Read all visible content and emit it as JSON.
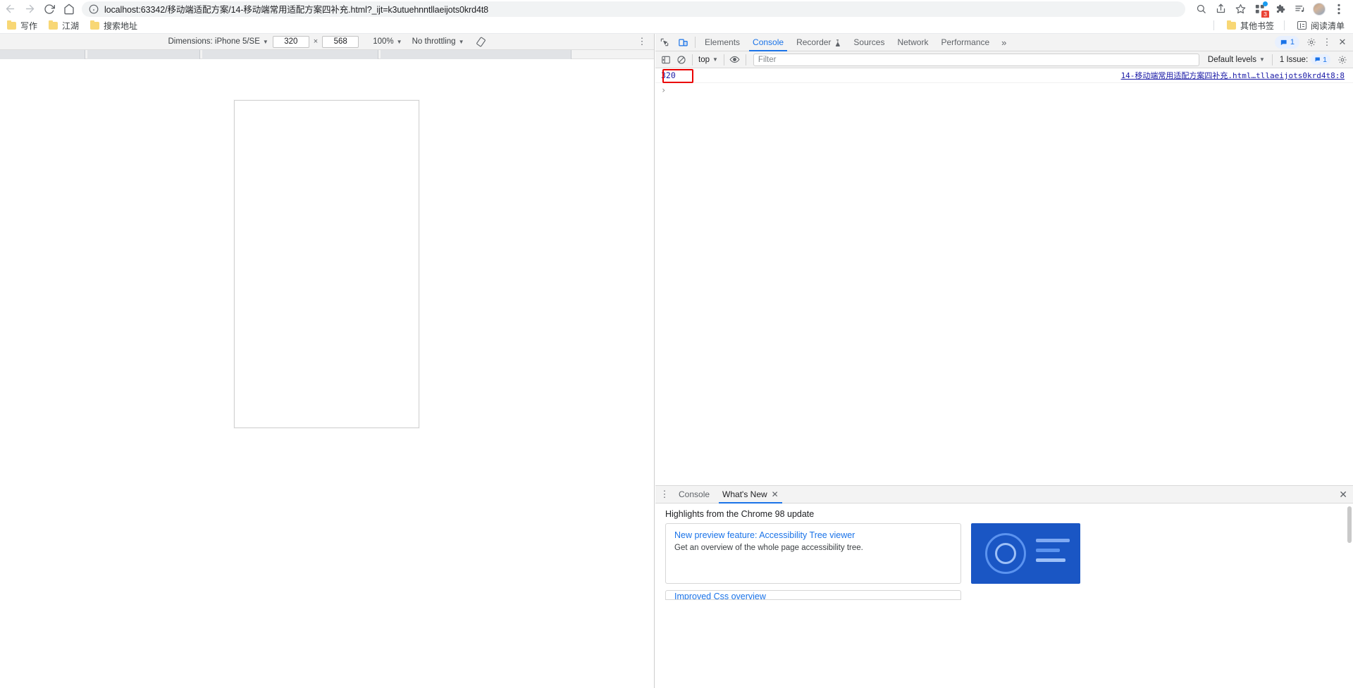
{
  "browser": {
    "url": "localhost:63342/移动端适配方案/14-移动端常用适配方案四补充.html?_ijt=k3utuehnntllaeijots0krd4t8",
    "nav": {
      "back": "back-arrow",
      "forward": "forward-arrow",
      "reload": "reload",
      "home": "home"
    },
    "toolbar_icons": [
      {
        "name": "search-icon",
        "label": ""
      },
      {
        "name": "share-icon",
        "label": ""
      },
      {
        "name": "bookmark-star-icon",
        "label": ""
      },
      {
        "name": "extensions-icon",
        "label": "",
        "badge": "3"
      },
      {
        "name": "puzzle-extension-icon",
        "label": ""
      },
      {
        "name": "reading-list-icon",
        "label": ""
      },
      {
        "name": "profile-avatar",
        "label": ""
      },
      {
        "name": "chrome-menu-icon",
        "label": "⋮"
      }
    ],
    "bookmarks": [
      {
        "label": "写作"
      },
      {
        "label": "江湖"
      },
      {
        "label": "搜索地址"
      }
    ],
    "bookmarks_right": [
      {
        "label": "其他书签"
      },
      {
        "label": "阅读清单"
      }
    ]
  },
  "device_toolbar": {
    "dimensions_label": "Dimensions: iPhone 5/SE",
    "width": "320",
    "height": "568",
    "times": "×",
    "zoom": "100%",
    "throttling": "No throttling",
    "rotate_title": "rotate-icon",
    "kebab": "⋮"
  },
  "devtools": {
    "tabs": [
      {
        "label": "Elements",
        "active": false
      },
      {
        "label": "Console",
        "active": true
      },
      {
        "label": "Recorder",
        "active": false,
        "badge": "rec"
      },
      {
        "label": "Sources",
        "active": false
      },
      {
        "label": "Network",
        "active": false
      },
      {
        "label": "Performance",
        "active": false
      }
    ],
    "more_tabs": "»",
    "issues_pill": "1",
    "gear": "⚙",
    "kebab": "⋮",
    "close": "✕",
    "console_toolbar": {
      "context": "top",
      "filter_placeholder": "Filter",
      "levels": "Default levels",
      "issues_text": "1 Issue:",
      "issues_count": "1"
    },
    "console_entries": [
      {
        "value": "320",
        "source": "14-移动端常用适配方案四补充.html…tllaeijots0krd4t8:8",
        "highlighted": true
      }
    ],
    "prompt_symbol": "›"
  },
  "drawer": {
    "tabs": [
      {
        "label": "Console",
        "active": false,
        "closable": false
      },
      {
        "label": "What's New",
        "active": true,
        "closable": true
      }
    ],
    "close_label": "✕",
    "kebab": "⋮",
    "heading": "Highlights from the Chrome 98 update",
    "cards": [
      {
        "title": "New preview feature: Accessibility Tree viewer",
        "description": "Get an overview of the whole page accessibility tree.",
        "thumb": "accessibility-tree-thumbnail"
      },
      {
        "title": "Improved Css overview",
        "description": ""
      }
    ]
  }
}
